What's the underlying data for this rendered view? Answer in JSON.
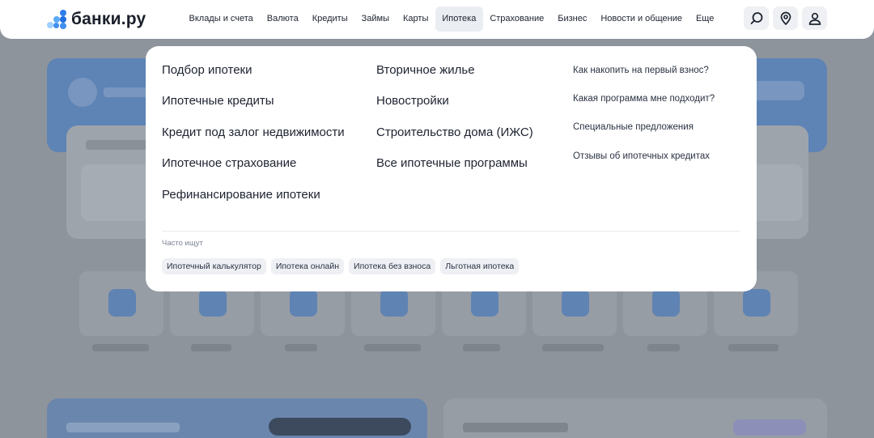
{
  "header": {
    "logo_text": "банки.ру",
    "nav": [
      {
        "label": "Вклады и счета",
        "active": false
      },
      {
        "label": "Валюта",
        "active": false
      },
      {
        "label": "Кредиты",
        "active": false
      },
      {
        "label": "Займы",
        "active": false
      },
      {
        "label": "Карты",
        "active": false
      },
      {
        "label": "Ипотека",
        "active": true
      },
      {
        "label": "Страхование",
        "active": false
      },
      {
        "label": "Бизнес",
        "active": false
      },
      {
        "label": "Новости и общение",
        "active": false
      },
      {
        "label": "Еще",
        "active": false
      }
    ],
    "icons": [
      "search-icon",
      "location-pin-icon",
      "user-icon"
    ]
  },
  "mega_menu": {
    "col1": [
      "Подбор ипотеки",
      "Ипотечные кредиты",
      "Кредит под залог недвижимости",
      "Ипотечное страхование",
      "Рефинансирование ипотеки"
    ],
    "col2": [
      "Вторичное жилье",
      "Новостройки",
      "Строительство дома (ИЖС)",
      "Все ипотечные программы"
    ],
    "col3": [
      "Как накопить на первый взнос?",
      "Какая программа мне подходит?",
      "Специальные предложения",
      "Отзывы об ипотечных кредитах"
    ],
    "often_label": "Часто ищут",
    "chips": [
      "Ипотечный калькулятор",
      "Ипотека онлайн",
      "Ипотека без взноса",
      "Льготная ипотека"
    ]
  },
  "colors": {
    "brand_blue": "#3f8ff0",
    "overlay": "#8e949c",
    "active_tab": "#eaedf1",
    "chip_bg": "#eef0f4"
  }
}
